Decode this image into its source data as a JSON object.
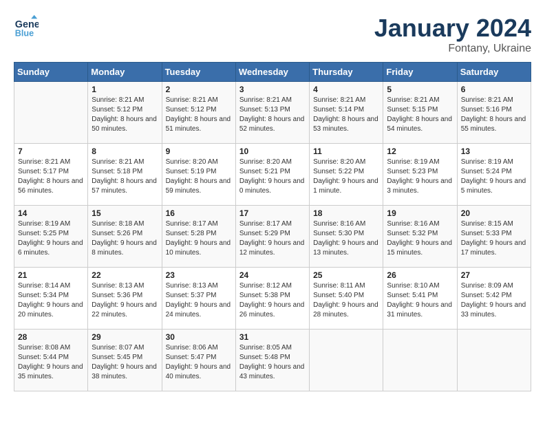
{
  "header": {
    "logo_line1": "General",
    "logo_line2": "Blue",
    "month_title": "January 2024",
    "location": "Fontany, Ukraine"
  },
  "weekdays": [
    "Sunday",
    "Monday",
    "Tuesday",
    "Wednesday",
    "Thursday",
    "Friday",
    "Saturday"
  ],
  "weeks": [
    [
      {
        "day": "",
        "sunrise": "",
        "sunset": "",
        "daylight": ""
      },
      {
        "day": "1",
        "sunrise": "Sunrise: 8:21 AM",
        "sunset": "Sunset: 5:12 PM",
        "daylight": "Daylight: 8 hours and 50 minutes."
      },
      {
        "day": "2",
        "sunrise": "Sunrise: 8:21 AM",
        "sunset": "Sunset: 5:12 PM",
        "daylight": "Daylight: 8 hours and 51 minutes."
      },
      {
        "day": "3",
        "sunrise": "Sunrise: 8:21 AM",
        "sunset": "Sunset: 5:13 PM",
        "daylight": "Daylight: 8 hours and 52 minutes."
      },
      {
        "day": "4",
        "sunrise": "Sunrise: 8:21 AM",
        "sunset": "Sunset: 5:14 PM",
        "daylight": "Daylight: 8 hours and 53 minutes."
      },
      {
        "day": "5",
        "sunrise": "Sunrise: 8:21 AM",
        "sunset": "Sunset: 5:15 PM",
        "daylight": "Daylight: 8 hours and 54 minutes."
      },
      {
        "day": "6",
        "sunrise": "Sunrise: 8:21 AM",
        "sunset": "Sunset: 5:16 PM",
        "daylight": "Daylight: 8 hours and 55 minutes."
      }
    ],
    [
      {
        "day": "7",
        "sunrise": "Sunrise: 8:21 AM",
        "sunset": "Sunset: 5:17 PM",
        "daylight": "Daylight: 8 hours and 56 minutes."
      },
      {
        "day": "8",
        "sunrise": "Sunrise: 8:21 AM",
        "sunset": "Sunset: 5:18 PM",
        "daylight": "Daylight: 8 hours and 57 minutes."
      },
      {
        "day": "9",
        "sunrise": "Sunrise: 8:20 AM",
        "sunset": "Sunset: 5:19 PM",
        "daylight": "Daylight: 8 hours and 59 minutes."
      },
      {
        "day": "10",
        "sunrise": "Sunrise: 8:20 AM",
        "sunset": "Sunset: 5:21 PM",
        "daylight": "Daylight: 9 hours and 0 minutes."
      },
      {
        "day": "11",
        "sunrise": "Sunrise: 8:20 AM",
        "sunset": "Sunset: 5:22 PM",
        "daylight": "Daylight: 9 hours and 1 minute."
      },
      {
        "day": "12",
        "sunrise": "Sunrise: 8:19 AM",
        "sunset": "Sunset: 5:23 PM",
        "daylight": "Daylight: 9 hours and 3 minutes."
      },
      {
        "day": "13",
        "sunrise": "Sunrise: 8:19 AM",
        "sunset": "Sunset: 5:24 PM",
        "daylight": "Daylight: 9 hours and 5 minutes."
      }
    ],
    [
      {
        "day": "14",
        "sunrise": "Sunrise: 8:19 AM",
        "sunset": "Sunset: 5:25 PM",
        "daylight": "Daylight: 9 hours and 6 minutes."
      },
      {
        "day": "15",
        "sunrise": "Sunrise: 8:18 AM",
        "sunset": "Sunset: 5:26 PM",
        "daylight": "Daylight: 9 hours and 8 minutes."
      },
      {
        "day": "16",
        "sunrise": "Sunrise: 8:17 AM",
        "sunset": "Sunset: 5:28 PM",
        "daylight": "Daylight: 9 hours and 10 minutes."
      },
      {
        "day": "17",
        "sunrise": "Sunrise: 8:17 AM",
        "sunset": "Sunset: 5:29 PM",
        "daylight": "Daylight: 9 hours and 12 minutes."
      },
      {
        "day": "18",
        "sunrise": "Sunrise: 8:16 AM",
        "sunset": "Sunset: 5:30 PM",
        "daylight": "Daylight: 9 hours and 13 minutes."
      },
      {
        "day": "19",
        "sunrise": "Sunrise: 8:16 AM",
        "sunset": "Sunset: 5:32 PM",
        "daylight": "Daylight: 9 hours and 15 minutes."
      },
      {
        "day": "20",
        "sunrise": "Sunrise: 8:15 AM",
        "sunset": "Sunset: 5:33 PM",
        "daylight": "Daylight: 9 hours and 17 minutes."
      }
    ],
    [
      {
        "day": "21",
        "sunrise": "Sunrise: 8:14 AM",
        "sunset": "Sunset: 5:34 PM",
        "daylight": "Daylight: 9 hours and 20 minutes."
      },
      {
        "day": "22",
        "sunrise": "Sunrise: 8:13 AM",
        "sunset": "Sunset: 5:36 PM",
        "daylight": "Daylight: 9 hours and 22 minutes."
      },
      {
        "day": "23",
        "sunrise": "Sunrise: 8:13 AM",
        "sunset": "Sunset: 5:37 PM",
        "daylight": "Daylight: 9 hours and 24 minutes."
      },
      {
        "day": "24",
        "sunrise": "Sunrise: 8:12 AM",
        "sunset": "Sunset: 5:38 PM",
        "daylight": "Daylight: 9 hours and 26 minutes."
      },
      {
        "day": "25",
        "sunrise": "Sunrise: 8:11 AM",
        "sunset": "Sunset: 5:40 PM",
        "daylight": "Daylight: 9 hours and 28 minutes."
      },
      {
        "day": "26",
        "sunrise": "Sunrise: 8:10 AM",
        "sunset": "Sunset: 5:41 PM",
        "daylight": "Daylight: 9 hours and 31 minutes."
      },
      {
        "day": "27",
        "sunrise": "Sunrise: 8:09 AM",
        "sunset": "Sunset: 5:42 PM",
        "daylight": "Daylight: 9 hours and 33 minutes."
      }
    ],
    [
      {
        "day": "28",
        "sunrise": "Sunrise: 8:08 AM",
        "sunset": "Sunset: 5:44 PM",
        "daylight": "Daylight: 9 hours and 35 minutes."
      },
      {
        "day": "29",
        "sunrise": "Sunrise: 8:07 AM",
        "sunset": "Sunset: 5:45 PM",
        "daylight": "Daylight: 9 hours and 38 minutes."
      },
      {
        "day": "30",
        "sunrise": "Sunrise: 8:06 AM",
        "sunset": "Sunset: 5:47 PM",
        "daylight": "Daylight: 9 hours and 40 minutes."
      },
      {
        "day": "31",
        "sunrise": "Sunrise: 8:05 AM",
        "sunset": "Sunset: 5:48 PM",
        "daylight": "Daylight: 9 hours and 43 minutes."
      },
      {
        "day": "",
        "sunrise": "",
        "sunset": "",
        "daylight": ""
      },
      {
        "day": "",
        "sunrise": "",
        "sunset": "",
        "daylight": ""
      },
      {
        "day": "",
        "sunrise": "",
        "sunset": "",
        "daylight": ""
      }
    ]
  ]
}
